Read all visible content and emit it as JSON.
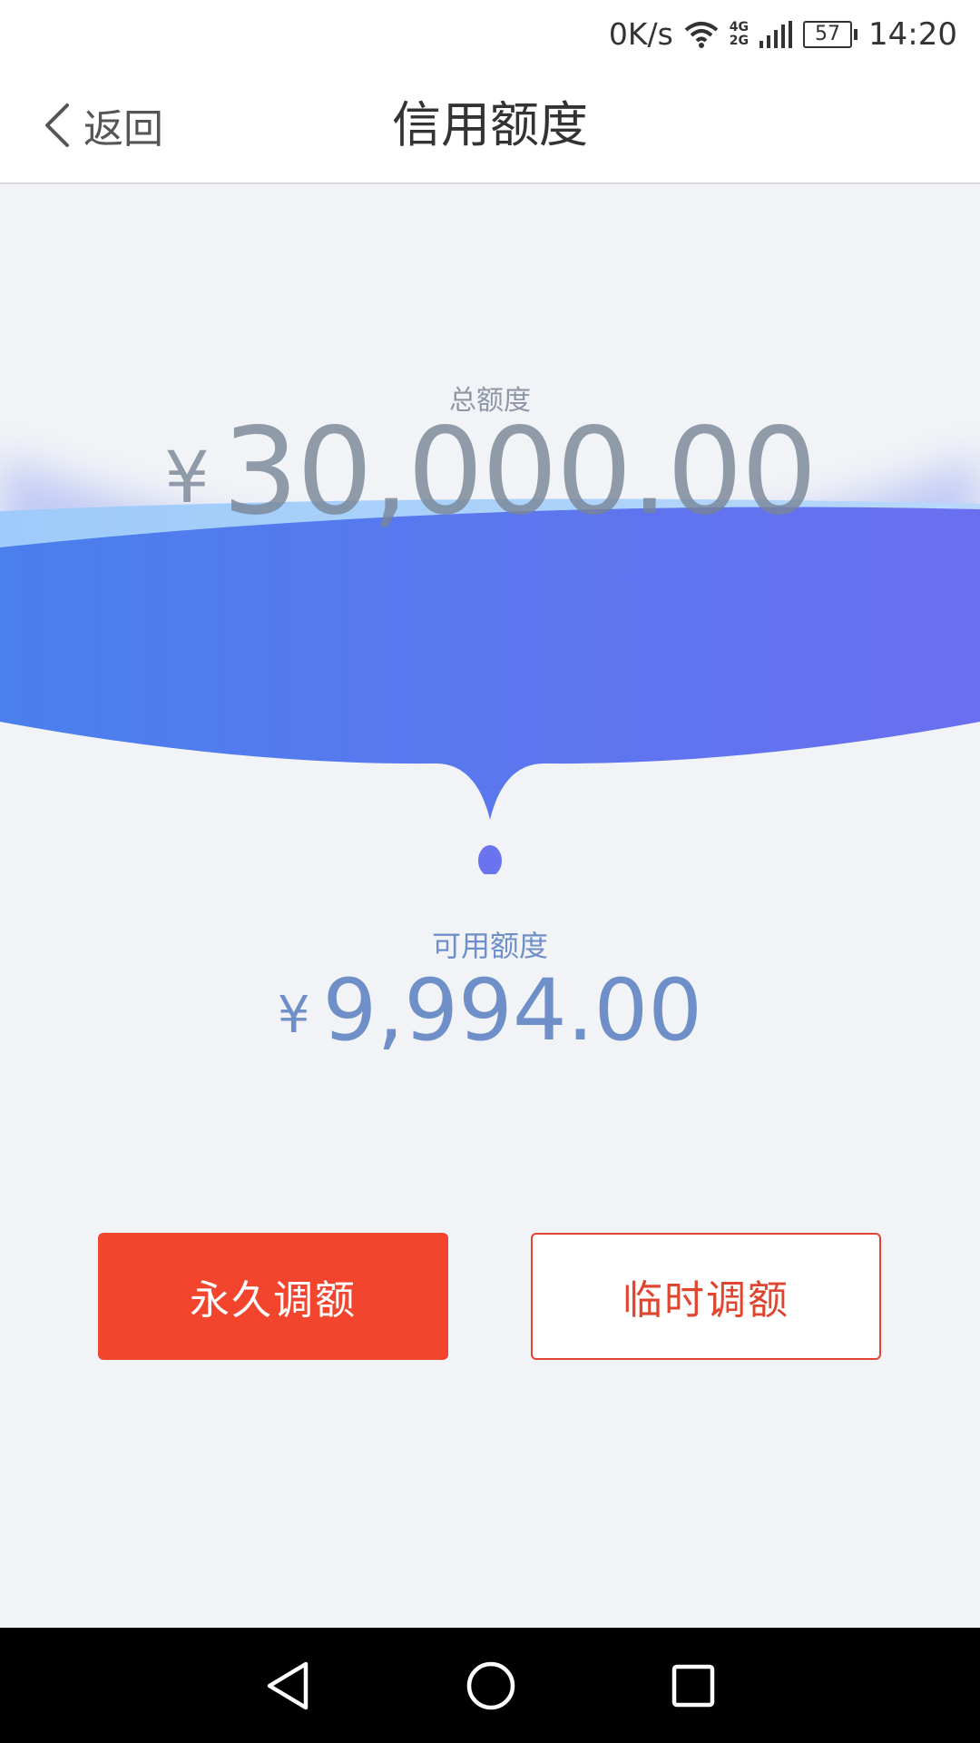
{
  "status_bar": {
    "net_speed": "0K/s",
    "network_tech_top": "4G",
    "network_tech_bottom": "2G",
    "battery_level": "57",
    "time": "14:20",
    "icons": [
      "wifi-icon",
      "signal-icon",
      "battery-icon"
    ]
  },
  "header": {
    "back_label": "返回",
    "title": "信用额度"
  },
  "credit": {
    "total_label": "总额度",
    "total_currency": "¥",
    "total_amount": "30,000.00",
    "available_label": "可用额度",
    "available_currency": "¥",
    "available_amount": "9,994.00"
  },
  "actions": {
    "permanent_label": "永久调额",
    "temporary_label": "临时调额"
  },
  "colors": {
    "primary_red": "#f3442e",
    "wave_blue_start": "#4a7fec",
    "wave_blue_end": "#6a6ff0",
    "available_text": "#6f8fc8"
  },
  "system_nav": {
    "icons": [
      "back-triangle-icon",
      "home-circle-icon",
      "recents-square-icon"
    ]
  }
}
